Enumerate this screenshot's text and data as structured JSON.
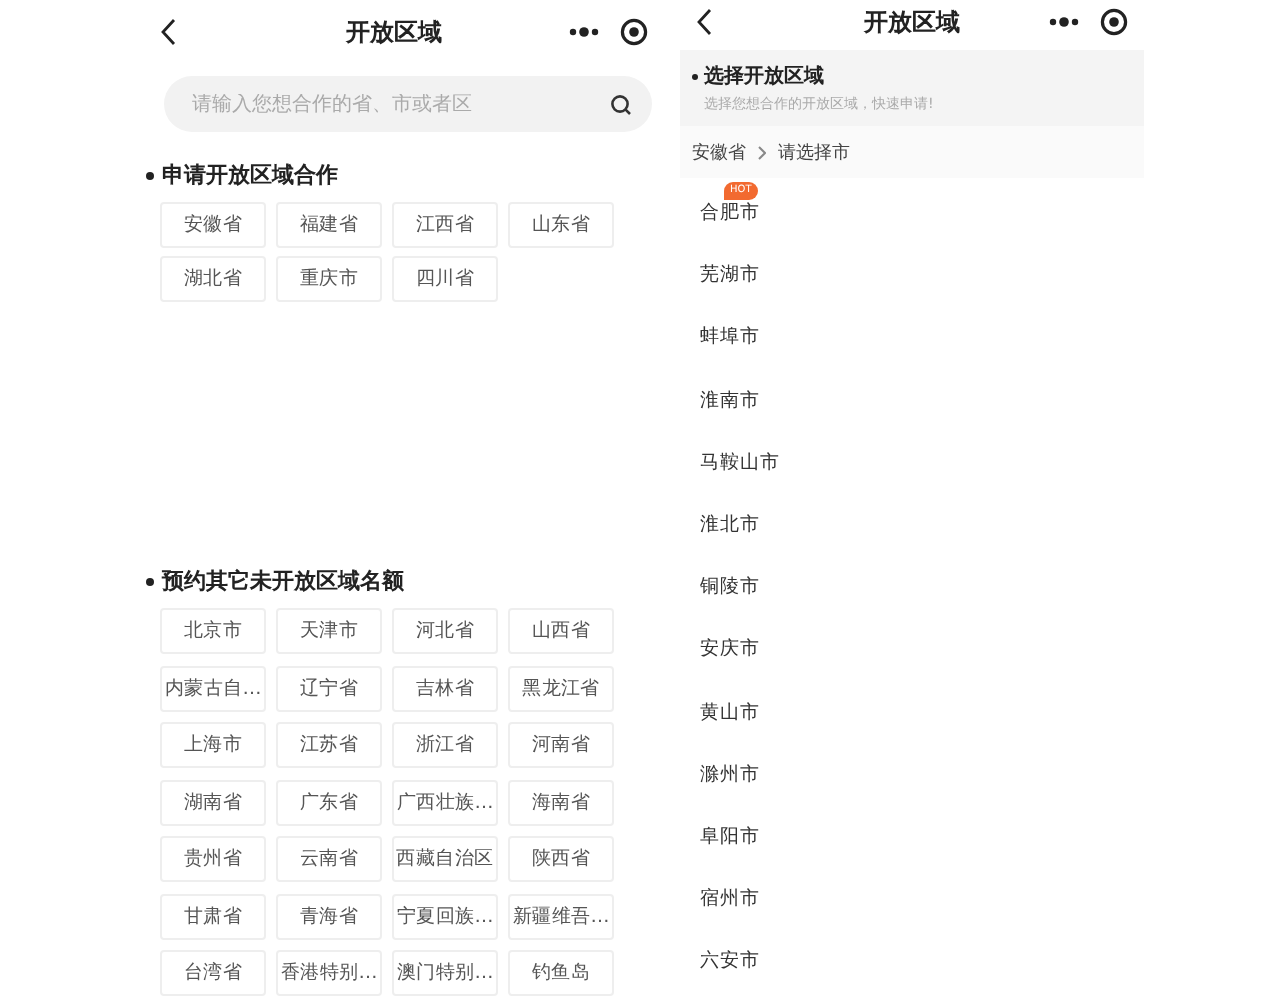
{
  "left": {
    "header": {
      "title": "开放区域"
    },
    "search": {
      "placeholder": "请输入您想合作的省、市或者区"
    },
    "sections": [
      {
        "heading": "申请开放区域合作",
        "chips": [
          "安徽省",
          "福建省",
          "江西省",
          "山东省",
          "湖北省",
          "重庆市",
          "四川省"
        ]
      },
      {
        "heading": "预约其它未开放区域名额",
        "chips": [
          "北京市",
          "天津市",
          "河北省",
          "山西省",
          "内蒙古自…",
          "辽宁省",
          "吉林省",
          "黑龙江省",
          "上海市",
          "江苏省",
          "浙江省",
          "河南省",
          "湖南省",
          "广东省",
          "广西壮族…",
          "海南省",
          "贵州省",
          "云南省",
          "西藏自治区",
          "陕西省",
          "甘肃省",
          "青海省",
          "宁夏回族…",
          "新疆维吾…",
          "台湾省",
          "香港特别…",
          "澳门特别…",
          "钓鱼岛"
        ]
      }
    ]
  },
  "right": {
    "header": {
      "title": "开放区域"
    },
    "prompt": {
      "heading": "选择开放区域",
      "subtitle": "选择您想合作的开放区域，快速申请!"
    },
    "breadcrumb": {
      "province": "安徽省",
      "next": "请选择市"
    },
    "cities": [
      {
        "name": "合肥市",
        "badge": "HOT"
      },
      {
        "name": "芜湖市"
      },
      {
        "name": "蚌埠市"
      },
      {
        "name": "淮南市"
      },
      {
        "name": "马鞍山市"
      },
      {
        "name": "淮北市"
      },
      {
        "name": "铜陵市"
      },
      {
        "name": "安庆市"
      },
      {
        "name": "黄山市"
      },
      {
        "name": "滁州市"
      },
      {
        "name": "阜阳市"
      },
      {
        "name": "宿州市"
      },
      {
        "name": "六安市"
      }
    ]
  }
}
